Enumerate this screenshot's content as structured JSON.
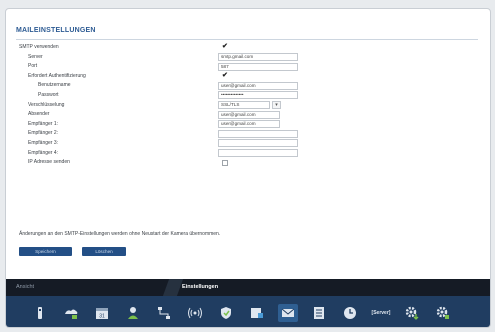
{
  "panel": {
    "title": "MAILEINSTELLUNGEN"
  },
  "form": {
    "smtp_use": {
      "label": "SMTP verwenden",
      "checked": true
    },
    "server": {
      "label": "Server",
      "value": "smtp.gmail.com"
    },
    "port": {
      "label": "Port",
      "value": "587"
    },
    "auth_required": {
      "label": "Erfordert Authentifizierung",
      "checked": true
    },
    "username": {
      "label": "Benutzername",
      "value": "user@gmail.com"
    },
    "password": {
      "label": "Passwort",
      "value": "••••••••••••••"
    },
    "encryption": {
      "label": "Verschlüsselung",
      "value": "SSL/TLS"
    },
    "sender": {
      "label": "Absender",
      "value": "user@gmail.com"
    },
    "recipient1": {
      "label": "Empfänger 1:",
      "value": "user@gmail.com"
    },
    "recipient2": {
      "label": "Empfänger 2:",
      "value": ""
    },
    "recipient3": {
      "label": "Empfänger 3:",
      "value": ""
    },
    "recipient4": {
      "label": "Empfänger 4:",
      "value": ""
    },
    "ip_address_send": {
      "label": "IP Adresse senden",
      "checked": false
    }
  },
  "note": "Änderungen an den SMTP-Einstellungen werden ohne Neustart der Kamera übernommen.",
  "buttons": {
    "save": "Speichern",
    "delete": "Löschen"
  },
  "tabs": {
    "left": "Ansicht",
    "right": "Einstellungen"
  },
  "iconbar": {
    "items": [
      "camera-info-icon",
      "network-icon",
      "calendar-icon",
      "user-icon",
      "network-nodes-icon",
      "wireless-icon",
      "shield-icon",
      "storage-icon",
      "mail-icon",
      "list-icon",
      "clock-icon",
      "server-label",
      "gear-download-icon",
      "gear-icon"
    ],
    "server_label": "[Server]",
    "active_index": 8
  },
  "colors": {
    "accent": "#2d5b93",
    "iconbar": "#203d61",
    "tabbar": "#151b25",
    "button": "#234f86"
  }
}
